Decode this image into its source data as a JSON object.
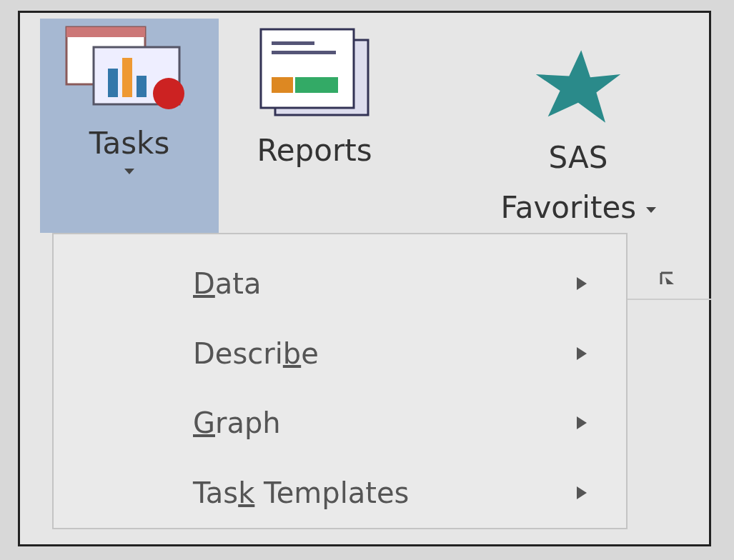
{
  "ribbon": {
    "buttons": [
      {
        "kind": "tasks",
        "label": "Tasks",
        "selected": true,
        "dropdown": true
      },
      {
        "kind": "reports",
        "label": "Reports",
        "selected": false,
        "dropdown": false
      },
      {
        "kind": "favorites",
        "label": "SAS Favorites",
        "selected": false,
        "dropdown": true
      }
    ]
  },
  "menu": {
    "items": [
      {
        "key": "D",
        "post": "ata",
        "submenu": true
      },
      {
        "pre": "Descri",
        "key": "b",
        "post": "e",
        "submenu": true
      },
      {
        "key": "G",
        "post": "raph",
        "submenu": true
      },
      {
        "pre": "Tas",
        "key": "k",
        "post": " Templates",
        "submenu": true
      }
    ]
  }
}
